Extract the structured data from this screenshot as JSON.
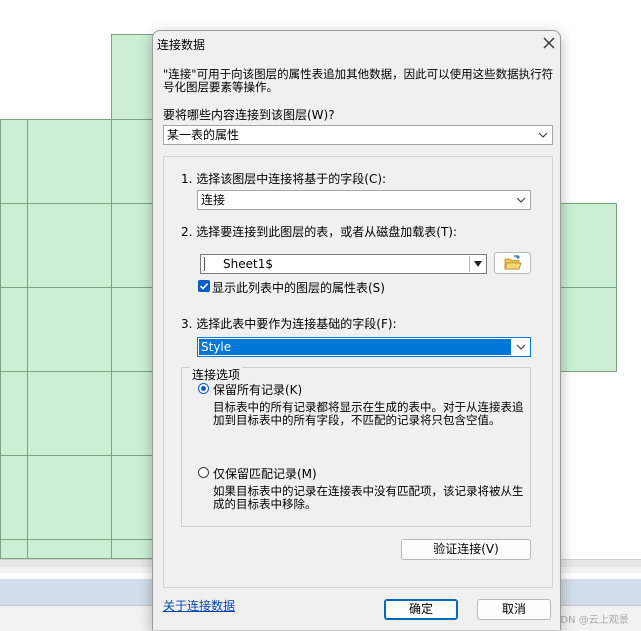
{
  "dialog": {
    "title": "连接数据",
    "description": "\"连接\"可用于向该图层的属性表追加其他数据，因此可以使用这些数据执行符号化图层要素等操作。",
    "what_label": "要将哪些内容连接到该图层(W)?",
    "what_value": "某一表的属性",
    "step1_label": "1. 选择该图层中连接将基于的字段(C):",
    "step1_value": "连接",
    "step2_label": "2. 选择要连接到此图层的表，或者从磁盘加载表(T):",
    "step2_value": "Sheet1$",
    "show_attr_tables": "显示此列表中的图层的属性表(S)",
    "step3_label": "3. 选择此表中要作为连接基础的字段(F):",
    "step3_value": "Style",
    "options_title": "连接选项",
    "keep_all_label": "保留所有记录(K)",
    "keep_all_desc": "目标表中的所有记录都将显示在生成的表中。对于从连接表追加到目标表中的所有字段，不匹配的记录将只包含空值。",
    "keep_match_label": "仅保留匹配记录(M)",
    "keep_match_desc": "如果目标表中的记录在连接表中没有匹配项，该记录将被从生成的目标表中移除。",
    "validate_button": "验证连接(V)",
    "about_link": "关于连接数据",
    "ok_button": "确定",
    "cancel_button": "取消"
  },
  "watermark": "CSDN @云上观景",
  "colors": {
    "map_fill": "#ccefd3",
    "map_border": "#7aa37f",
    "accent": "#0078d7",
    "checkbox": "#0b5cc7",
    "link": "#0645ad"
  }
}
